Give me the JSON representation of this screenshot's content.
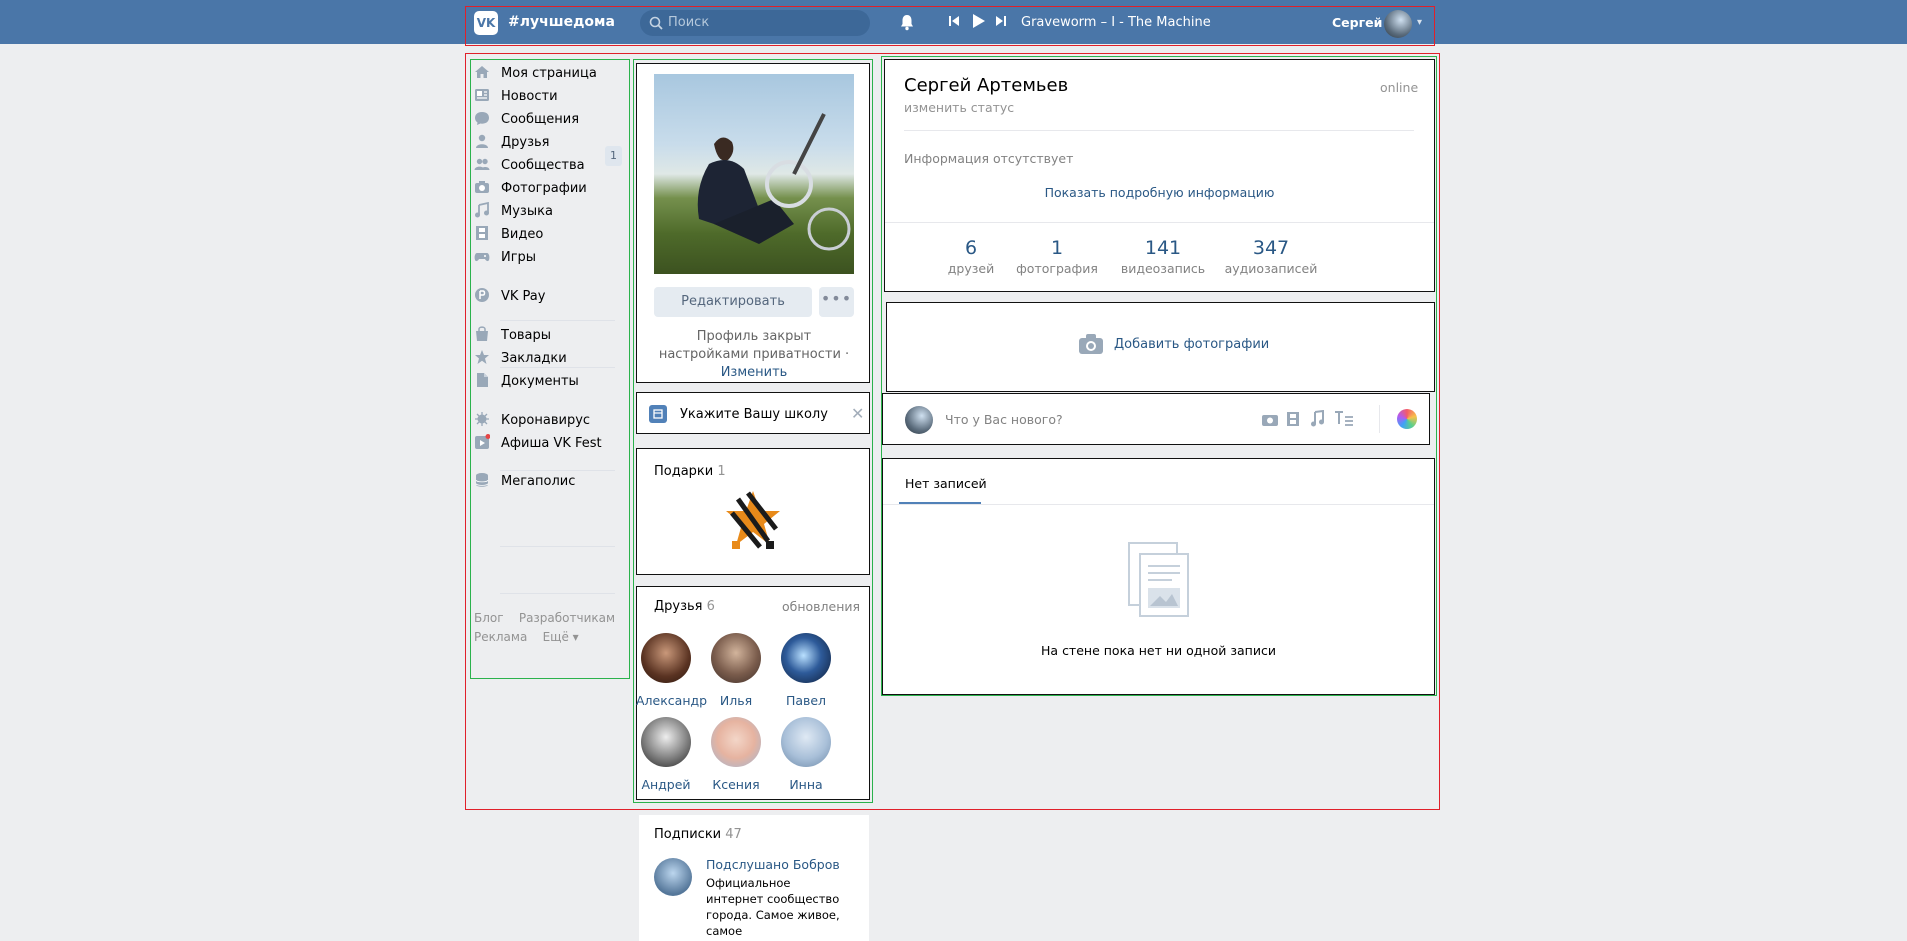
{
  "header": {
    "logo": "VK",
    "hashtag": "#лучшедома",
    "search_placeholder": "Поиск",
    "track": "Graveworm – I - The Machine",
    "username": "Сергей"
  },
  "menu": {
    "items": [
      {
        "label": "Моя страница",
        "icon": "home-icon"
      },
      {
        "label": "Новости",
        "icon": "news-icon"
      },
      {
        "label": "Сообщения",
        "icon": "messages-icon"
      },
      {
        "label": "Друзья",
        "icon": "friends-icon",
        "badge": "1"
      },
      {
        "label": "Сообщества",
        "icon": "groups-icon"
      },
      {
        "label": "Фотографии",
        "icon": "camera-icon"
      },
      {
        "label": "Музыка",
        "icon": "music-icon"
      },
      {
        "label": "Видео",
        "icon": "video-icon"
      },
      {
        "label": "Игры",
        "icon": "games-icon"
      },
      {
        "label": "VK Pay",
        "icon": "vkpay-icon"
      },
      {
        "label": "Товары",
        "icon": "goods-icon"
      },
      {
        "label": "Закладки",
        "icon": "star-icon"
      },
      {
        "label": "Документы",
        "icon": "document-icon"
      },
      {
        "label": "Коронавирус",
        "icon": "virus-icon"
      },
      {
        "label": "Афиша VK Fest",
        "icon": "afisha-icon"
      },
      {
        "label": "Мегаполис",
        "icon": "database-icon"
      }
    ],
    "footer": {
      "blog": "Блог",
      "dev": "Разработчикам",
      "ads": "Реклама",
      "more": "Ещё"
    }
  },
  "profile": {
    "edit_label": "Редактировать",
    "more_label": "•••",
    "privacy_text": "Профиль закрыт настройками приватности ·",
    "privacy_link": "Изменить",
    "school_prompt": "Укажите Вашу школу",
    "gifts_title": "Подарки",
    "gifts_count": "1",
    "friends_title": "Друзья",
    "friends_count": "6",
    "friends_updates": "обновления",
    "friends": [
      {
        "name": "Александр"
      },
      {
        "name": "Илья"
      },
      {
        "name": "Павел"
      },
      {
        "name": "Андрей"
      },
      {
        "name": "Ксения"
      },
      {
        "name": "Инна"
      }
    ],
    "subs_title": "Подписки",
    "subs_count": "47",
    "sub_name": "Подслушано Бобров",
    "sub_desc": "Официальное интернет сообщество города. Самое живое, самое"
  },
  "info": {
    "name": "Сергей Артемьев",
    "online": "online",
    "status": "изменить статус",
    "no_info": "Информация отсутствует",
    "show_more": "Показать подробную информацию",
    "stats": [
      {
        "n": "6",
        "l": "друзей"
      },
      {
        "n": "1",
        "l": "фотография"
      },
      {
        "n": "141",
        "l": "видеозапись"
      },
      {
        "n": "347",
        "l": "аудиозаписей"
      }
    ],
    "add_photos": "Добавить фотографии",
    "post_placeholder": "Что у Вас нового?",
    "wall_tab": "Нет записей",
    "wall_empty": "На стене пока нет ни одной записи"
  }
}
